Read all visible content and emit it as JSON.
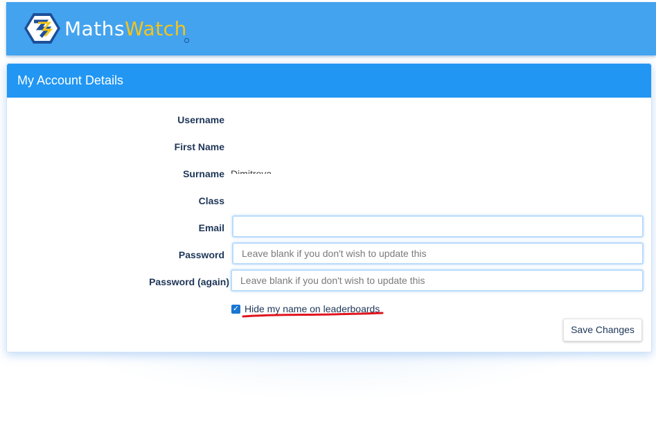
{
  "header": {
    "logo_part1": "Maths",
    "logo_part2": "Watch",
    "colors": {
      "bar": "#43a3ef",
      "logo_accent": "#f5c518"
    }
  },
  "panel": {
    "title": "My Account Details",
    "fields": {
      "username_label": "Username",
      "firstname_label": "First Name",
      "surname_label": "Surname",
      "surname_value": "Dimitrova",
      "class_label": "Class",
      "email_label": "Email",
      "email_value": "",
      "password_label": "Password",
      "password_placeholder": "Leave blank if you don't wish to update this",
      "password_again_label": "Password (again)",
      "password_again_placeholder": "Leave blank if you don't wish to update this"
    },
    "hide_name": {
      "checked": true,
      "label": "Hide my name on leaderboards"
    },
    "save_label": "Save Changes"
  }
}
